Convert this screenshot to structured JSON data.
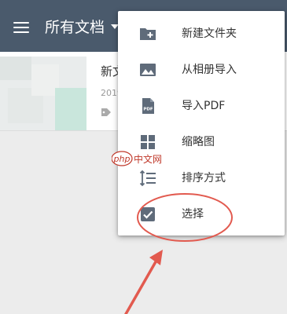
{
  "appbar": {
    "title": "所有文档",
    "colors": {
      "bg": "#4a5a6c",
      "text": "#ffffff"
    }
  },
  "document": {
    "title_partial": "新文",
    "date_partial": "2019"
  },
  "dropdown": {
    "items": [
      {
        "label": "新建文件夹",
        "icon": "new-folder-icon"
      },
      {
        "label": "从相册导入",
        "icon": "image-icon"
      },
      {
        "label": "导入PDF",
        "icon": "pdf-file-icon"
      },
      {
        "label": "缩略图",
        "icon": "grid-view-icon"
      },
      {
        "label": "排序方式",
        "icon": "sort-icon"
      },
      {
        "label": "选择",
        "icon": "checkbox-icon"
      }
    ],
    "pdf_badge_text": "PDF"
  },
  "watermark": {
    "php": "php",
    "cn": "中文网"
  },
  "annotation": {
    "color": "#e25a4f"
  }
}
